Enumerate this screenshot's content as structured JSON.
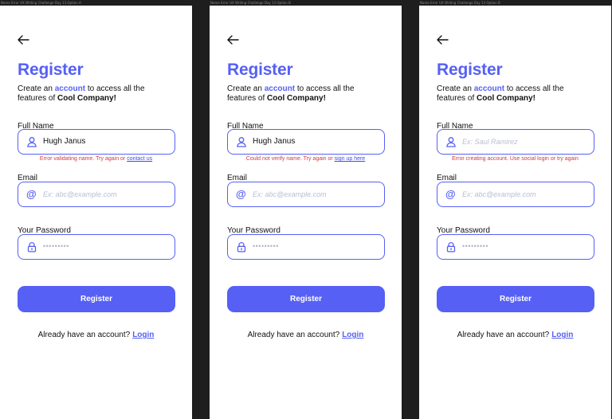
{
  "frames": [
    {
      "frame_label": "Name Error UX Writing Challenge Day 13 Option A",
      "title": "Register",
      "subtitle": {
        "pre": "Create an ",
        "accent": "account",
        "mid": " to access all the features of ",
        "bold": "Cool Company!"
      },
      "name_label": "Full Name",
      "name_value": "Hugh Janus",
      "name_placeholder": "",
      "error_text": "Error validating name. Try again or ",
      "error_link": "contact us",
      "email_label": "Email",
      "email_placeholder": "Ex: abc@example.com",
      "password_label": "Your Password",
      "password_mask": "•••••••••",
      "button_label": "Register",
      "footer_text": "Already have an account?",
      "login_link": "Login"
    },
    {
      "frame_label": "Name Error UX Writing Challenge Day 13 Option B",
      "title": "Register",
      "subtitle": {
        "pre": "Create an ",
        "accent": "account",
        "mid": " to access all the features of ",
        "bold": "Cool Company!"
      },
      "name_label": "Full Name",
      "name_value": "Hugh Janus",
      "name_placeholder": "",
      "error_text": "Could not verify name. Try again or ",
      "error_link": "sign up here",
      "email_label": "Email",
      "email_placeholder": "Ex: abc@example.com",
      "password_label": "Your Password",
      "password_mask": "•••••••••",
      "button_label": "Register",
      "footer_text": "Already have an account?",
      "login_link": "Login"
    },
    {
      "frame_label": "Name Error UX Writing Challenge Day 13 Option B",
      "title": "Register",
      "subtitle": {
        "pre": "Create an ",
        "accent": "account",
        "mid": " to access all the features of ",
        "bold": "Cool Company!"
      },
      "name_label": "Full Name",
      "name_value": "",
      "name_placeholder": "Ex: Saul Ramirez",
      "error_text": "Error creating account. Use social login or try again",
      "error_link": "",
      "email_label": "Email",
      "email_placeholder": "Ex: abc@example.com",
      "password_label": "Your Password",
      "password_mask": "•••••••••",
      "button_label": "Register",
      "footer_text": "Already have an account?",
      "login_link": "Login"
    }
  ],
  "icons": {
    "back": "arrow-left-icon",
    "name": "user-icon",
    "email": "at-sign-icon",
    "password": "lock-icon"
  },
  "colors": {
    "accent": "#5660f5",
    "error": "#d13b3b",
    "background": "#1e1e1e"
  }
}
